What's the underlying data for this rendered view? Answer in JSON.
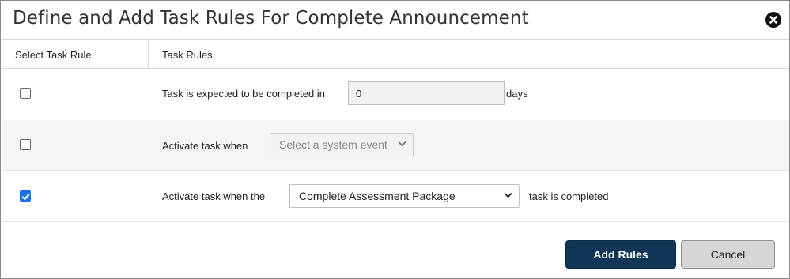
{
  "dialog": {
    "title": "Define and Add Task Rules For Complete Announcement",
    "close_icon": "close-circle-icon"
  },
  "table": {
    "headers": [
      "Select Task Rule",
      "Task Rules"
    ],
    "rows": [
      {
        "checked": false,
        "prefix": "Task is expected to be completed in",
        "input_value": "0",
        "suffix": "days"
      },
      {
        "checked": false,
        "prefix": "Activate task when",
        "select_value": "Select a system event",
        "select_disabled": true
      },
      {
        "checked": true,
        "prefix": "Activate task when the",
        "select_value": "Complete Assessment Package",
        "suffix": "task is completed"
      }
    ]
  },
  "footer": {
    "add_label": "Add Rules",
    "cancel_label": "Cancel"
  },
  "colors": {
    "primary_button": "#0f3557",
    "checkbox_checked": "#1a73e8",
    "alt_row": "#f5f5f5"
  }
}
